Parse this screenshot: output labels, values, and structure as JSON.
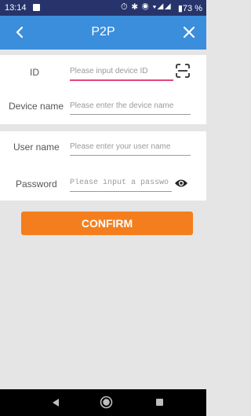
{
  "status_bar": {
    "time": "13:14",
    "icons": "⏱ ✱ ◉ ▾◢◢",
    "battery": "▮73 %"
  },
  "header": {
    "title": "P2P"
  },
  "device_section": {
    "id_label": "ID",
    "id_placeholder": "Please input device ID",
    "name_label": "Device name",
    "name_placeholder": "Please enter the device name"
  },
  "user_section": {
    "username_label": "User name",
    "username_placeholder": "Please enter your user name",
    "password_label": "Password",
    "password_placeholder": "Please input a passwo"
  },
  "confirm_label": "CONFIRM",
  "colors": {
    "status_bar": "#27346b",
    "app_bar": "#3a8edc",
    "confirm": "#f47e1d",
    "active_underline": "#e6457f"
  }
}
